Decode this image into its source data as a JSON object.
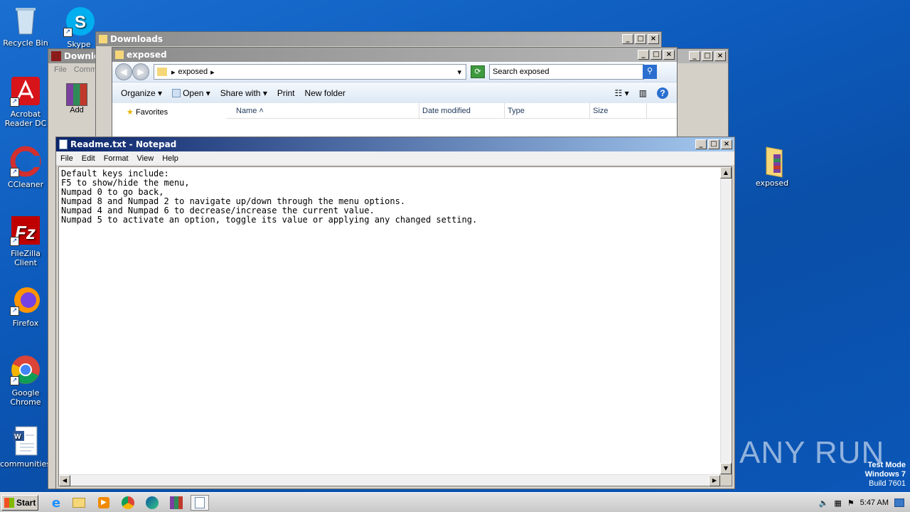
{
  "desktop": {
    "icons": [
      {
        "label": "Recycle Bin",
        "icon": "recycle-bin-icon"
      },
      {
        "label": "Skype",
        "icon": "skype-icon"
      },
      {
        "label": "Acrobat Reader DC",
        "icon": "acrobat-icon"
      },
      {
        "label": "CCleaner",
        "icon": "ccleaner-icon"
      },
      {
        "label": "FileZilla Client",
        "icon": "filezilla-icon"
      },
      {
        "label": "Firefox",
        "icon": "firefox-icon"
      },
      {
        "label": "Google Chrome",
        "icon": "chrome-icon"
      },
      {
        "label": "communities...",
        "icon": "word-doc-icon"
      },
      {
        "label": "exposed",
        "icon": "folder-icon"
      }
    ],
    "watermark": {
      "brand": "ANY RUN",
      "line1": "Test Mode",
      "line2": "Windows 7",
      "line3": "Build 7601"
    }
  },
  "windows": {
    "downloads_explorer": {
      "title": "Downloads"
    },
    "downloads_winrar": {
      "title": "Downloa",
      "menu": [
        "File",
        "Comm"
      ],
      "toolbar": {
        "add_label": "Add"
      }
    },
    "exposed_explorer": {
      "title": "exposed",
      "address": "exposed",
      "search_placeholder": "Search exposed",
      "commands": [
        "Organize",
        "Open",
        "Share with",
        "Print",
        "New folder"
      ],
      "sidebar": {
        "favorites": "Favorites"
      },
      "columns": [
        "Name",
        "Date modified",
        "Type",
        "Size"
      ]
    },
    "notepad": {
      "title": "Readme.txt - Notepad",
      "menu": [
        "File",
        "Edit",
        "Format",
        "View",
        "Help"
      ],
      "content": "Default keys include:\nF5 to show/hide the menu,\nNumpad 0 to go back,\nNumpad 8 and Numpad 2 to navigate up/down through the menu options.\nNumpad 4 and Numpad 6 to decrease/increase the current value.\nNumpad 5 to activate an option, toggle its value or applying any changed setting."
    }
  },
  "taskbar": {
    "start_label": "Start",
    "clock": "5:47 AM",
    "apps": [
      "ie-icon",
      "explorer-icon",
      "media-player-icon",
      "chrome-icon",
      "edge-icon",
      "winrar-icon",
      "notepad-icon"
    ]
  }
}
